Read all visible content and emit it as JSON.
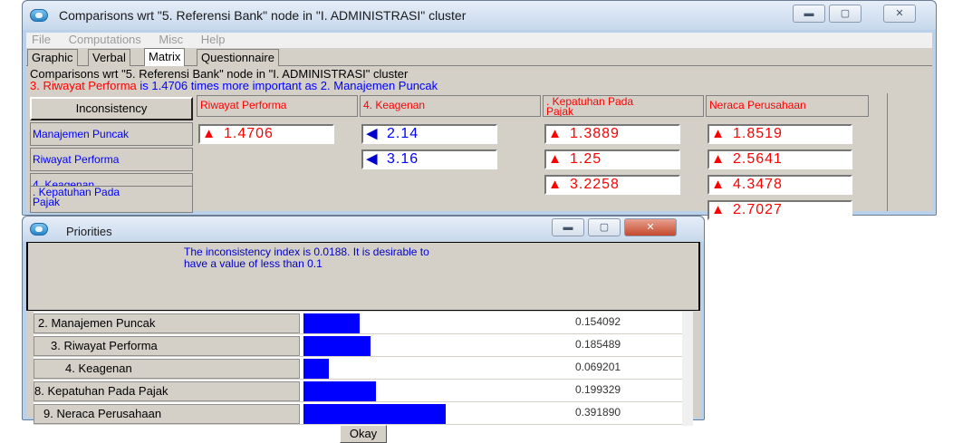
{
  "main_window": {
    "title": "Comparisons wrt \"5. Referensi Bank\" node in \"I. ADMINISTRASI\" cluster",
    "menu": [
      "File",
      "Computations",
      "Misc",
      "Help"
    ],
    "tabs": [
      "Graphic",
      "Verbal",
      "Matrix",
      "Questionnaire"
    ],
    "active_tab": "Matrix",
    "info_line1": "Comparisons wrt \"5. Referensi Bank\" node in \"I. ADMINISTRASI\" cluster",
    "info_line2": {
      "part1": "3. Riwayat Performa",
      "part2": " is 1.4706 times more important as ",
      "part3": "2. Manajemen Puncak"
    },
    "inconsistency_button": "Inconsistency",
    "columns": [
      "Riwayat Performa",
      "4. Keagenan",
      ". Kepatuhan Pada\nPajak",
      "Neraca Perusahaan"
    ],
    "rows": [
      "Manajemen Puncak",
      "Riwayat Performa",
      "4. Keagenan",
      ". Kepatuhan Pada\nPajak"
    ],
    "cells": [
      {
        "row": 0,
        "col": 0,
        "value": "1.4706",
        "direction": "up"
      },
      {
        "row": 0,
        "col": 1,
        "value": "2.14",
        "direction": "left"
      },
      {
        "row": 0,
        "col": 2,
        "value": "1.3889",
        "direction": "up"
      },
      {
        "row": 0,
        "col": 3,
        "value": "1.8519",
        "direction": "up"
      },
      {
        "row": 1,
        "col": 1,
        "value": "3.16",
        "direction": "left"
      },
      {
        "row": 1,
        "col": 2,
        "value": "1.25",
        "direction": "up"
      },
      {
        "row": 1,
        "col": 3,
        "value": "2.5641",
        "direction": "up"
      },
      {
        "row": 2,
        "col": 2,
        "value": "3.2258",
        "direction": "up"
      },
      {
        "row": 2,
        "col": 3,
        "value": "4.3478",
        "direction": "up"
      },
      {
        "row": 3,
        "col": 3,
        "value": "2.7027",
        "direction": "up"
      }
    ],
    "colors": {
      "up_arrow": "#ff0000",
      "left_arrow": "#0000cc"
    }
  },
  "priorities_window": {
    "title": "Priorities",
    "inconsistency_message": "The inconsistency index is 0.0188.  It is desirable to have a value of less than 0.1",
    "items": [
      {
        "label": "2. Manajemen Puncak",
        "value": "0.154092",
        "fraction": 0.154092
      },
      {
        "label": "3. Riwayat Performa",
        "value": "0.185489",
        "fraction": 0.185489
      },
      {
        "label": "4. Keagenan",
        "value": "0.069201",
        "fraction": 0.069201
      },
      {
        "label": "8. Kepatuhan Pada Pajak",
        "value": "0.199329",
        "fraction": 0.199329
      },
      {
        "label": "9. Neraca Perusahaan",
        "value": "0.391890",
        "fraction": 0.39189
      }
    ],
    "bar_color": "#0000ff",
    "okay_button": "Okay"
  }
}
